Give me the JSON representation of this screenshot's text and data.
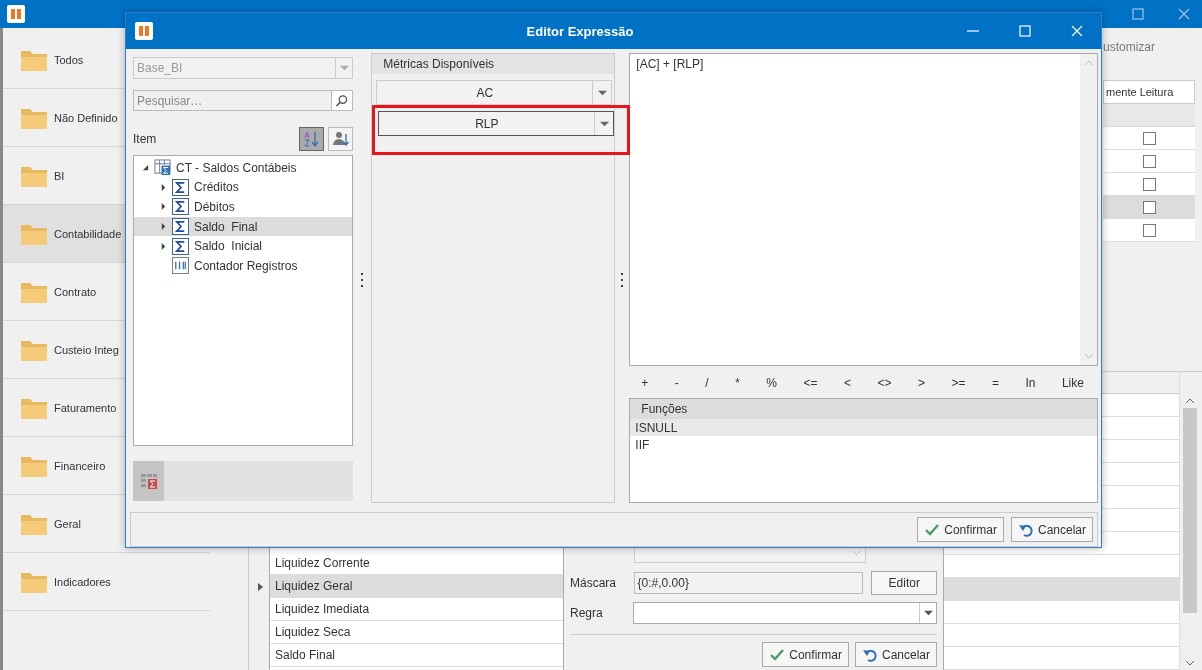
{
  "app": {
    "sidebar": [
      {
        "label": "Todos",
        "selected": false
      },
      {
        "label": "Não Definido",
        "selected": false
      },
      {
        "label": "BI",
        "selected": false
      },
      {
        "label": "Contabilidade",
        "selected": true
      },
      {
        "label": "Contrato",
        "selected": false
      },
      {
        "label": "Custeio Integ",
        "selected": false
      },
      {
        "label": "Faturamento",
        "selected": false
      },
      {
        "label": "Financeiro",
        "selected": false
      },
      {
        "label": "Geral",
        "selected": false
      },
      {
        "label": "Indicadores",
        "selected": false
      }
    ],
    "toolbar_text": "ustomizar",
    "readonly_table": {
      "header": "mente Leitura",
      "rows": [
        {
          "checked": false,
          "selected": false
        },
        {
          "checked": false,
          "selected": false
        },
        {
          "checked": false,
          "selected": false
        },
        {
          "checked": false,
          "selected": true
        },
        {
          "checked": false,
          "selected": false
        }
      ]
    },
    "metrics_grid": {
      "rows": [
        {
          "label": "Liquidez Corrente",
          "selected": false
        },
        {
          "label": "Liquidez Geral",
          "selected": true
        },
        {
          "label": "Liquidez Imediata",
          "selected": false
        },
        {
          "label": "Liquidez Seca",
          "selected": false
        },
        {
          "label": "Saldo  Final",
          "selected": false
        }
      ]
    },
    "form": {
      "mask_label": "Máscara",
      "mask_value": "{0:#,0.00}",
      "editor_button": "Editor",
      "rule_label": "Regra",
      "buttons": [
        {
          "label": "Confirmar",
          "kind": "confirm"
        },
        {
          "label": "Cancelar",
          "kind": "cancel"
        }
      ]
    },
    "side_table": {
      "rows": [
        {
          "selected": false
        },
        {
          "selected": false
        },
        {
          "selected": false
        },
        {
          "selected": false
        },
        {
          "selected": false
        },
        {
          "selected": false
        },
        {
          "selected": false
        },
        {
          "selected": false
        },
        {
          "selected": true
        },
        {
          "selected": false
        },
        {
          "selected": false
        },
        {
          "selected": false
        }
      ]
    }
  },
  "dialog": {
    "title": "Editor Expressão",
    "connection": {
      "value": "Base_BI",
      "disabled": true
    },
    "search": {
      "placeholder": "Pesquisar…"
    },
    "item_label": "Item",
    "sort_buttons": [
      {
        "kind": "alpha",
        "selected": true
      },
      {
        "kind": "user",
        "selected": false
      }
    ],
    "tree": [
      {
        "label": "CT - Saldos Contábeis",
        "kind": "table",
        "expanded": true,
        "selected": false,
        "children": [
          {
            "label": "Créditos",
            "kind": "measure",
            "expanded": false,
            "selected": false
          },
          {
            "label": "Débitos",
            "kind": "measure",
            "expanded": false,
            "selected": false
          },
          {
            "label": "Saldo  Final",
            "kind": "measure",
            "expanded": false,
            "selected": true
          },
          {
            "label": "Saldo  Inicial",
            "kind": "measure",
            "expanded": false,
            "selected": false
          },
          {
            "label": "Contador Registros",
            "kind": "count",
            "selected": false
          }
        ]
      }
    ],
    "metrics": {
      "title": "Métricas Disponíveis",
      "combos": [
        {
          "value": "AC",
          "highlighted": false
        },
        {
          "value": "RLP",
          "highlighted": true
        }
      ]
    },
    "expression": "[AC] + [RLP]",
    "operators": [
      "+",
      "-",
      "/",
      "*",
      "%",
      "<=",
      "<",
      "<>",
      ">",
      ">=",
      "=",
      "In",
      "Like"
    ],
    "functions": {
      "title": "Funções",
      "items": [
        {
          "label": "ISNULL",
          "selected": true
        },
        {
          "label": "IIF",
          "selected": false
        }
      ]
    },
    "buttons": [
      {
        "label": "Confirmar",
        "kind": "confirm"
      },
      {
        "label": "Cancelar",
        "kind": "cancel"
      }
    ]
  }
}
